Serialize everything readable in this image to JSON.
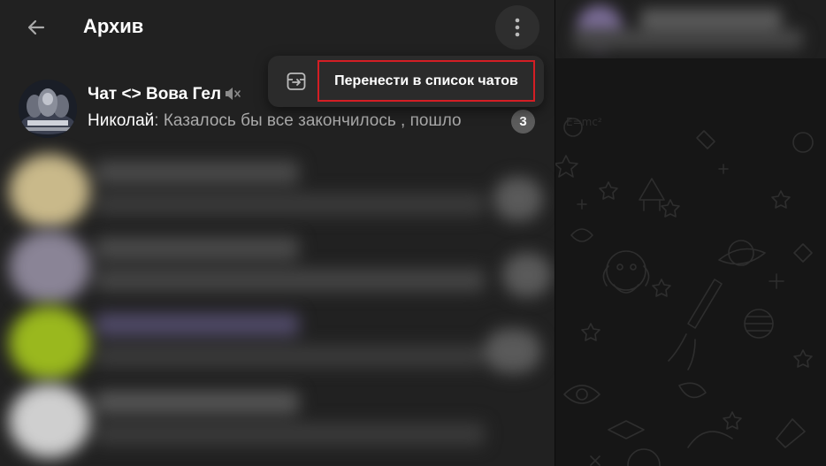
{
  "header": {
    "title": "Архив"
  },
  "chats": [
    {
      "name": "Чат <> Вова Гел",
      "sender": "Николай",
      "separator": ": ",
      "preview": "Казалось бы все закончилось , пошло",
      "unread": "3"
    }
  ],
  "context_menu": {
    "items": [
      {
        "label": "Перенести в список чатов",
        "icon": "unarchive-icon"
      }
    ]
  },
  "colors": {
    "panel_bg": "#212121",
    "chat_bg": "#161616",
    "menu_bg": "#2b2b2b",
    "highlight": "#d41e24",
    "badge": "#5c5c5c",
    "preview_text": "#aaaaaa"
  }
}
